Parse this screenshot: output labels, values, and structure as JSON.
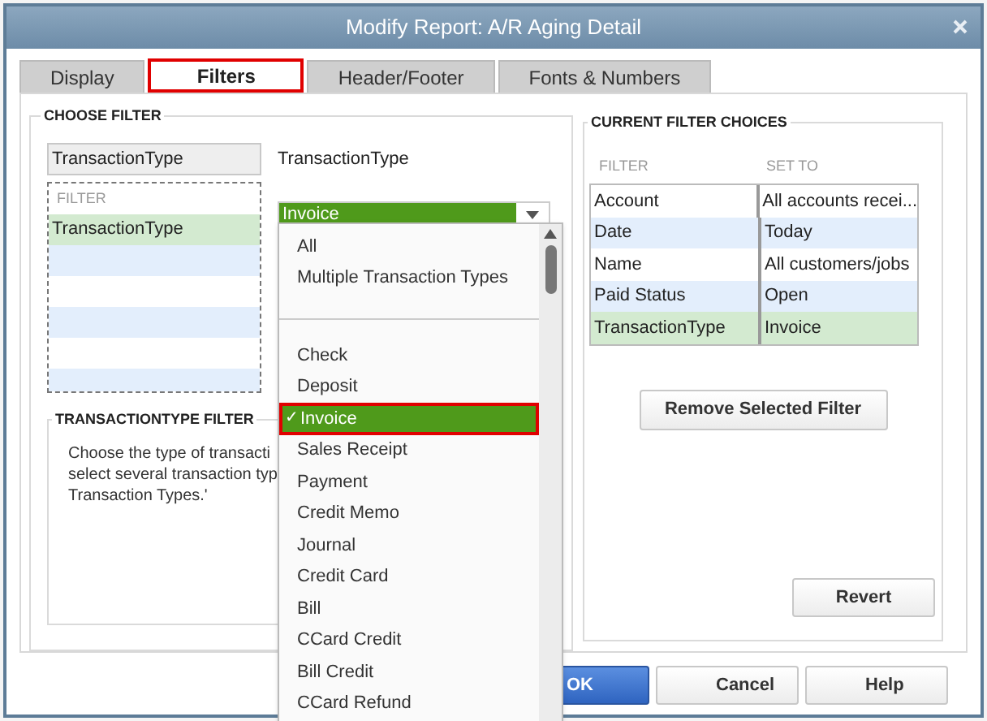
{
  "window": {
    "title": "Modify Report: A/R Aging Detail"
  },
  "tabs": [
    {
      "label": "Display",
      "selected": false
    },
    {
      "label": "Filters",
      "selected": true
    },
    {
      "label": "Header/Footer",
      "selected": false
    },
    {
      "label": "Fonts & Numbers",
      "selected": false
    }
  ],
  "choose_filter": {
    "heading": "CHOOSE FILTER",
    "search_value": "TransactionType",
    "list_header": "FILTER",
    "items": [
      {
        "label": "TransactionType",
        "selected": true
      }
    ],
    "field_label": "TransactionType",
    "combo_value": "Invoice",
    "help_heading": "TRANSACTIONTYPE FILTER",
    "help_lines": [
      "Choose the type of transacti",
      "select several transaction typ",
      "Transaction Types.'"
    ]
  },
  "dropdown": {
    "check_mark": "✓",
    "items": [
      {
        "kind": "option",
        "label": "All",
        "selected": false
      },
      {
        "kind": "option",
        "label": "Multiple Transaction Types",
        "selected": false
      },
      {
        "kind": "separator"
      },
      {
        "kind": "option",
        "label": "Check",
        "selected": false
      },
      {
        "kind": "option",
        "label": "Deposit",
        "selected": false
      },
      {
        "kind": "option",
        "label": "Invoice",
        "selected": true
      },
      {
        "kind": "option",
        "label": "Sales Receipt",
        "selected": false
      },
      {
        "kind": "option",
        "label": "Payment",
        "selected": false
      },
      {
        "kind": "option",
        "label": "Credit Memo",
        "selected": false
      },
      {
        "kind": "option",
        "label": "Journal",
        "selected": false
      },
      {
        "kind": "option",
        "label": "Credit Card",
        "selected": false
      },
      {
        "kind": "option",
        "label": "Bill",
        "selected": false
      },
      {
        "kind": "option",
        "label": "CCard Credit",
        "selected": false
      },
      {
        "kind": "option",
        "label": "Bill Credit",
        "selected": false
      },
      {
        "kind": "option",
        "label": "CCard Refund",
        "selected": false
      }
    ]
  },
  "current_filters": {
    "heading": "CURRENT FILTER CHOICES",
    "columns": [
      "FILTER",
      "SET TO"
    ],
    "rows": [
      {
        "filter": "Account",
        "set_to": "All accounts recei...",
        "selected": false
      },
      {
        "filter": "Date",
        "set_to": "Today",
        "selected": false
      },
      {
        "filter": "Name",
        "set_to": "All customers/jobs",
        "selected": false
      },
      {
        "filter": "Paid Status",
        "set_to": "Open",
        "selected": false
      },
      {
        "filter": "TransactionType",
        "set_to": "Invoice",
        "selected": true
      }
    ],
    "remove_button": "Remove Selected Filter",
    "revert_button": "Revert"
  },
  "buttons": [
    {
      "label": "OK",
      "default": true
    },
    {
      "label": "Cancel",
      "default": false
    },
    {
      "label": "Help",
      "default": false
    }
  ]
}
